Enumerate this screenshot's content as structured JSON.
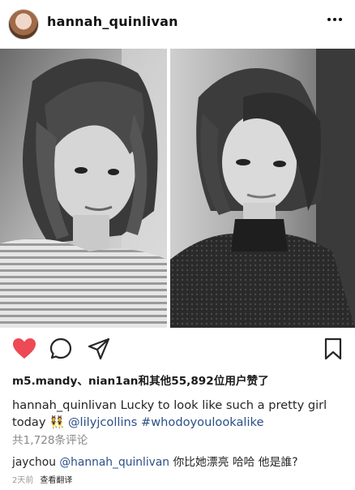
{
  "post": {
    "username": "hannah_quinlivan"
  },
  "likes": {
    "text": "m5.mandy、nian1an和其他55,892位用户赞了"
  },
  "caption": {
    "username": "hannah_quinlivan",
    "text_before": " Lucky to look like such a pretty girl today ",
    "emoji": "👯",
    "mention": "@lilyjcollins",
    "hashtag": "#whodoyoulookalike"
  },
  "comments": {
    "count_text": "共1,728条评论",
    "items": [
      {
        "username": "jaychou",
        "mention": "@hannah_quinlivan",
        "text": " 你比她漂亮 哈哈 他是誰?"
      }
    ]
  },
  "meta": {
    "time": "2天前",
    "translate": "查看翻译"
  },
  "colors": {
    "like_heart": "#ed4956",
    "link": "#2b4f86"
  }
}
